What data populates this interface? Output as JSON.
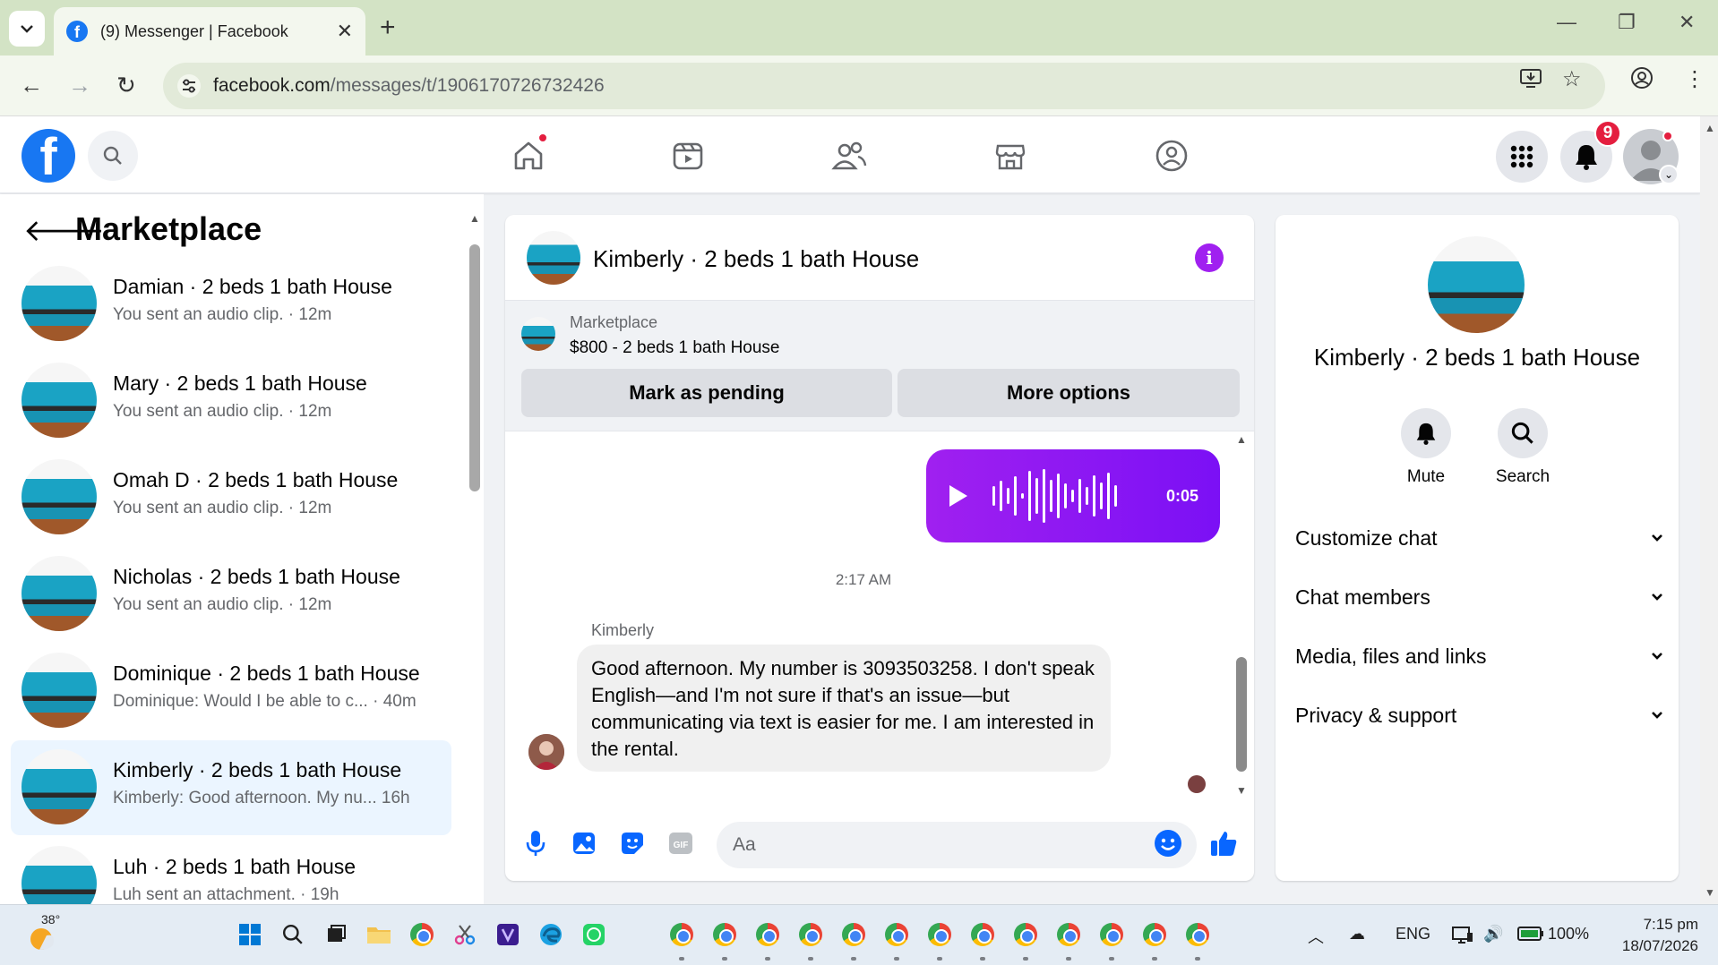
{
  "browser": {
    "tab_title": "(9) Messenger | Facebook",
    "url_domain": "facebook.com",
    "url_path": "/messages/t/1906170726732426"
  },
  "fb_nav": {
    "notification_count": "9"
  },
  "sidebar": {
    "title": "Marketplace",
    "conversations": [
      {
        "name": "Damian · 2 beds 1 bath House",
        "preview": "You sent an audio clip. · 12m",
        "active": false
      },
      {
        "name": "Mary · 2 beds 1 bath House",
        "preview": "You sent an audio clip. · 12m",
        "active": false
      },
      {
        "name": "Omah D · 2 beds 1 bath House",
        "preview": "You sent an audio clip. · 12m",
        "active": false
      },
      {
        "name": "Nicholas · 2 beds 1 bath House",
        "preview": "You sent an audio clip. · 12m",
        "active": false
      },
      {
        "name": "Dominique · 2 beds 1 bath House",
        "preview": "Dominique: Would I be able to c... · 40m",
        "active": false
      },
      {
        "name": "Kimberly · 2 beds 1 bath House",
        "preview": "Kimberly: Good afternoon. My nu...   16h",
        "active": true
      },
      {
        "name": "Luh · 2 beds 1 bath House",
        "preview": "Luh sent an attachment. · 19h",
        "active": false
      }
    ]
  },
  "chat": {
    "title": "Kimberly · 2 beds 1 bath House",
    "marketplace_label": "Marketplace",
    "listing": "$800 - 2 beds 1 bath House",
    "mark_pending_label": "Mark as pending",
    "more_options_label": "More options",
    "audio_duration": "0:05",
    "timestamp": "2:17 AM",
    "sender_name": "Kimberly",
    "message": "Good afternoon. My number is 3093503258. I don't speak English—and I'm not sure if that's an issue—but communicating via text is easier for me. I am interested in the rental.",
    "input_placeholder": "Aa"
  },
  "info_panel": {
    "name": "Kimberly · 2 beds 1 bath House",
    "mute_label": "Mute",
    "search_label": "Search",
    "sections": [
      "Customize chat",
      "Chat members",
      "Media, files and links",
      "Privacy & support"
    ]
  },
  "taskbar": {
    "temperature": "38°",
    "language": "ENG",
    "battery": "100%",
    "time": "7:15 pm",
    "date": "18/07/2026"
  },
  "colors": {
    "facebook_blue": "#1877f2",
    "messenger_purple": "#a020f0",
    "notification_red": "#e41e3f",
    "active_row": "#ebf5ff"
  }
}
